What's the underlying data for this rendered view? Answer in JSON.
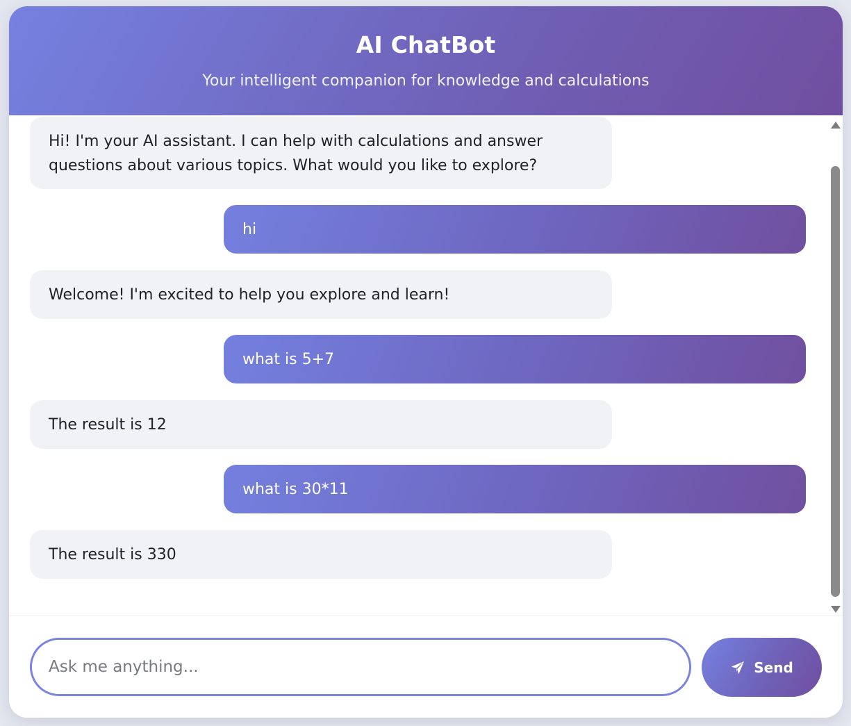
{
  "header": {
    "title": "AI ChatBot",
    "subtitle": "Your intelligent companion for knowledge and calculations"
  },
  "messages": [
    {
      "role": "bot",
      "text": "Hi! I'm your AI assistant. I can help with calculations and answer questions about various topics. What would you like to explore?"
    },
    {
      "role": "user",
      "text": "hi"
    },
    {
      "role": "bot",
      "text": "Welcome! I'm excited to help you explore and learn!"
    },
    {
      "role": "user",
      "text": "what is 5+7"
    },
    {
      "role": "bot",
      "text": "The result is 12"
    },
    {
      "role": "user",
      "text": "what is 30*11"
    },
    {
      "role": "bot",
      "text": "The result is 330"
    }
  ],
  "input": {
    "value": "",
    "placeholder": "Ask me anything..."
  },
  "send_button": {
    "label": "Send",
    "icon": "paper-plane-icon"
  },
  "colors": {
    "accent_start": "#7581e0",
    "accent_end": "#704e9f",
    "bot_bubble": "#f1f2f5",
    "page_bg": "#e4e7ef"
  }
}
